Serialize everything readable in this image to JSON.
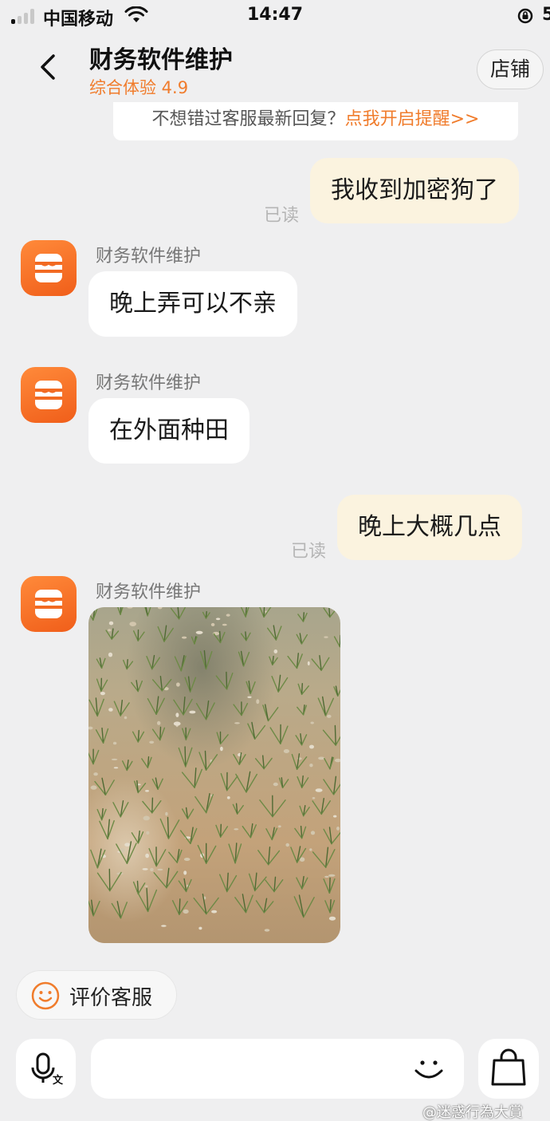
{
  "status_bar": {
    "carrier": "中国移动",
    "time": "14:47",
    "battery": "5"
  },
  "header": {
    "title": "财务软件维护",
    "rating": "综合体验 4.9",
    "shop_button": "店铺"
  },
  "notice": {
    "text": "不想错过客服最新回复？",
    "link": "点我开启提醒>>"
  },
  "messages": [
    {
      "side": "out",
      "text": "我收到加密狗了",
      "status": "已读"
    },
    {
      "side": "in",
      "sender": "财务软件维护",
      "text": "晚上弄可以不亲"
    },
    {
      "side": "in",
      "sender": "财务软件维护",
      "text": "在外面种田"
    },
    {
      "side": "out",
      "text": "晚上大概几点",
      "status": "已读"
    },
    {
      "side": "in",
      "sender": "财务软件维护",
      "type": "image",
      "image_subject": "rice-paddy-photo"
    }
  ],
  "rate_button": "评价客服",
  "input": {
    "placeholder": ""
  },
  "icons": {
    "back": "chevron-left-icon",
    "avatar": "store-icon",
    "rate": "smile-icon",
    "voice": "voice-to-text-icon",
    "emoji": "emoji-icon",
    "bag": "shopping-bag-icon"
  },
  "colors": {
    "accent": "#f07c2c",
    "outgoing_bubble": "#fbf3df",
    "incoming_bubble": "#ffffff",
    "background": "#efeff0"
  },
  "watermark": "@迷惑行為大賞"
}
